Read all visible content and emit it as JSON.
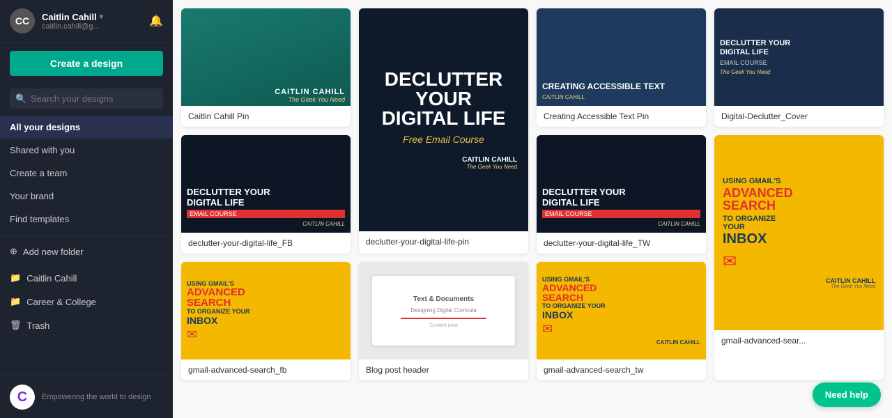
{
  "sidebar": {
    "user": {
      "name": "Caitlin Cahill",
      "email": "caitlin.cahill@g...",
      "avatar_initials": "CC"
    },
    "create_button": "Create a design",
    "search_placeholder": "Search your designs",
    "nav_items": [
      {
        "id": "all-designs",
        "label": "All your designs",
        "active": true
      },
      {
        "id": "shared",
        "label": "Shared with you",
        "active": false
      },
      {
        "id": "create-team",
        "label": "Create a team",
        "active": false
      },
      {
        "id": "your-brand",
        "label": "Your brand",
        "active": false
      },
      {
        "id": "find-templates",
        "label": "Find templates",
        "active": false
      }
    ],
    "folders": [
      {
        "id": "caitlin-cahill",
        "label": "Caitlin Cahill",
        "icon": "folder"
      },
      {
        "id": "career-college",
        "label": "Career & College",
        "icon": "folder"
      },
      {
        "id": "trash",
        "label": "Trash",
        "icon": "trash"
      }
    ],
    "add_folder_label": "Add new folder",
    "footer": {
      "tagline": "Empowering the world to design"
    }
  },
  "main": {
    "designs": [
      {
        "id": 1,
        "label": "Caitlin Cahill Pin",
        "thumb_type": "teal-pin",
        "col": 1
      },
      {
        "id": 2,
        "label": "declutter-your-digital-life_FB",
        "thumb_type": "declutter-email",
        "col": 1
      },
      {
        "id": 3,
        "label": "gmail-advanced-search_fb",
        "thumb_type": "gmail-advanced",
        "col": 1
      },
      {
        "id": 4,
        "label": "declutter-your-digital-life-pin",
        "thumb_type": "declutter-email",
        "col": 2,
        "large": true
      },
      {
        "id": 5,
        "label": "Blog post header",
        "thumb_type": "blog-post",
        "col": 2
      },
      {
        "id": 6,
        "label": "Creating Accessible Text Pin",
        "thumb_type": "creating-text",
        "col": 3
      },
      {
        "id": 7,
        "label": "declutter-your-digital-life_TW",
        "thumb_type": "declutter-email",
        "col": 3
      },
      {
        "id": 8,
        "label": "gmail-advanced-search_tw",
        "thumb_type": "gmail-advanced",
        "col": 3
      },
      {
        "id": 9,
        "label": "Digital-Declutter_Cover",
        "thumb_type": "digital-declutter",
        "col": 4
      },
      {
        "id": 10,
        "label": "gmail-advanced-sear...",
        "thumb_type": "gmail-tw",
        "col": 4
      }
    ]
  },
  "need_help": "Need help"
}
